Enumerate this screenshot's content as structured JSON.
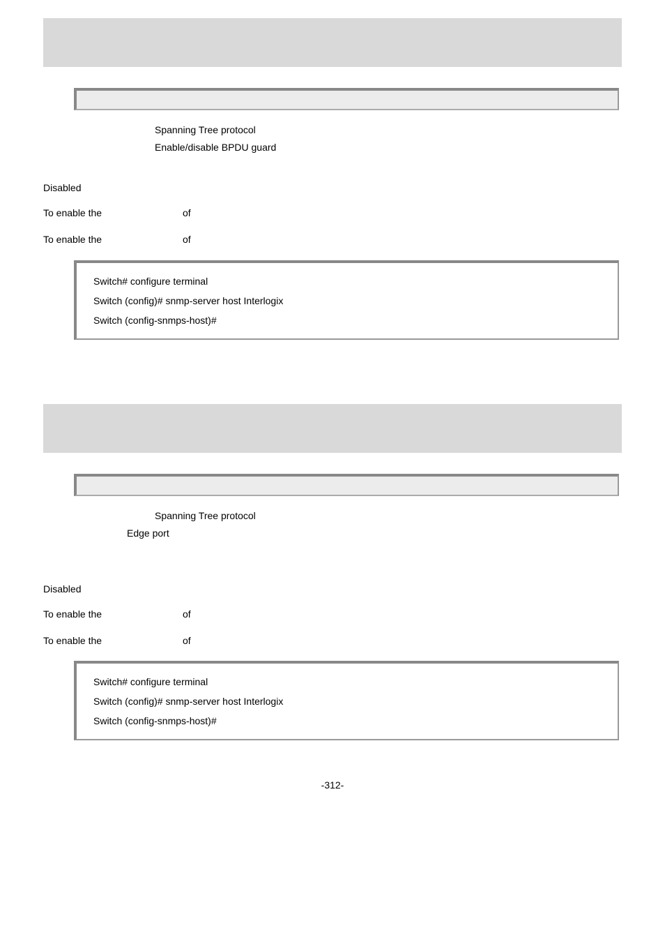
{
  "section1": {
    "row_spanning_label": "Spanning Tree protocol",
    "row_bpdu_label": "Enable/disable BPDU guard",
    "disabled": "Disabled",
    "enable1_left": "To enable the",
    "enable1_mid": "of",
    "enable2_left": "To enable the",
    "enable2_mid": "of",
    "example_l1": "Switch# configure terminal",
    "example_l2": "Switch (config)# snmp-server host Interlogix",
    "example_l3": "Switch (config-snmps-host)#"
  },
  "section2": {
    "row_spanning_label": "Spanning Tree protocol",
    "row_edge_label": "Edge port",
    "disabled": "Disabled",
    "enable1_left": "To enable the",
    "enable1_mid": "of",
    "enable2_left": "To enable the",
    "enable2_mid": "of",
    "example_l1": "Switch# configure terminal",
    "example_l2": "Switch (config)# snmp-server host Interlogix",
    "example_l3": "Switch (config-snmps-host)#"
  },
  "footer": "-312-"
}
